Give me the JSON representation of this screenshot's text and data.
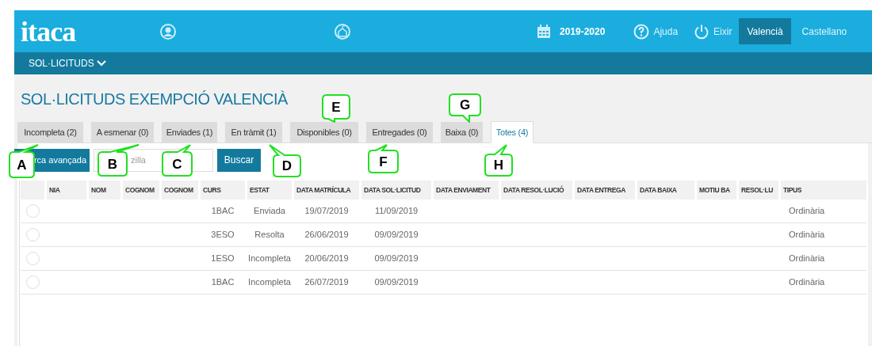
{
  "header": {
    "logo": "itaca",
    "year": "2019-2020",
    "help": "Ajuda",
    "exit": "Eixir",
    "languages": [
      {
        "label": "Valencià",
        "selected": true
      },
      {
        "label": "Castellano",
        "selected": false
      }
    ]
  },
  "menu": {
    "label": "SOL·LICITUDS"
  },
  "title": "SOL·LICITUDS EXEMPCIÓ VALENCIÀ",
  "tabs": [
    {
      "label": "Incompleta (2)",
      "selected": false
    },
    {
      "label": "A esmenar (0)",
      "selected": false
    },
    {
      "label": "Enviades (1)",
      "selected": false
    },
    {
      "label": "En tràmit (1)",
      "selected": false
    },
    {
      "label": "Disponibles (0)",
      "selected": false
    },
    {
      "label": "Entregades (0)",
      "selected": false
    },
    {
      "label": "Baixa (0)",
      "selected": false
    },
    {
      "label": "Totes (4)",
      "selected": true
    }
  ],
  "search": {
    "advanced_button": "rca avançada",
    "placeholder": "zilla",
    "search_button": "Buscar"
  },
  "table": {
    "columns": [
      "NIA",
      "NOM",
      "COGNOM",
      "COGNOM",
      "CURS",
      "ESTAT",
      "DATA MATRÍCULA",
      "DATA SOL·LICITUD",
      "DATA ENVIAMENT",
      "DATA RESOL·LUCIÓ",
      "DATA ENTREGA",
      "DATA BAIXA",
      "MOTIU BA",
      "RESOL·LU",
      "TIPUS"
    ],
    "rows": [
      {
        "selected": false,
        "curs": "1BAC",
        "estat": "Enviada",
        "data_matricula": "19/07/2019",
        "data_sol_licitud": "11/09/2019",
        "tipus": "Ordinària"
      },
      {
        "selected": false,
        "curs": "3ESO",
        "estat": "Resolta",
        "data_matricula": "26/06/2019",
        "data_sol_licitud": "09/09/2019",
        "tipus": "Ordinària"
      },
      {
        "selected": false,
        "curs": "1ESO",
        "estat": "Incompleta",
        "data_matricula": "20/06/2019",
        "data_sol_licitud": "09/09/2019",
        "tipus": "Ordinària"
      },
      {
        "selected": false,
        "curs": "1BAC",
        "estat": "Incompleta",
        "data_matricula": "26/07/2019",
        "data_sol_licitud": "09/09/2019",
        "tipus": "Ordinària"
      }
    ]
  },
  "callouts": [
    {
      "label": "A"
    },
    {
      "label": "B"
    },
    {
      "label": "C"
    },
    {
      "label": "D"
    },
    {
      "label": "E"
    },
    {
      "label": "F"
    },
    {
      "label": "G"
    },
    {
      "label": "H"
    }
  ]
}
